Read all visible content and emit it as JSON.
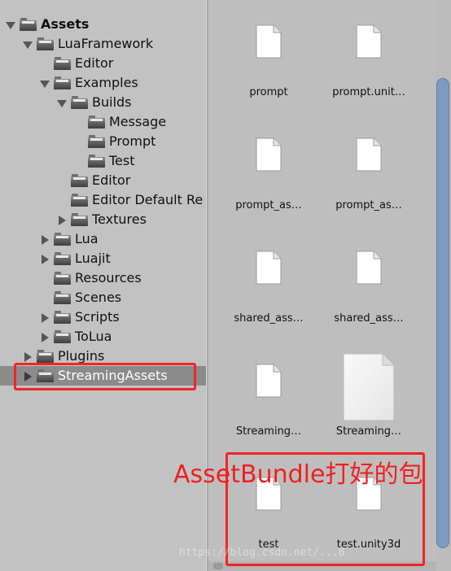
{
  "tree": [
    {
      "label": "Assets",
      "depth": 0,
      "state": "expanded",
      "bold": true
    },
    {
      "label": "LuaFramework",
      "depth": 1,
      "state": "expanded"
    },
    {
      "label": "Editor",
      "depth": 2,
      "state": "none"
    },
    {
      "label": "Examples",
      "depth": 2,
      "state": "expanded"
    },
    {
      "label": "Builds",
      "depth": 3,
      "state": "expanded"
    },
    {
      "label": "Message",
      "depth": 4,
      "state": "none"
    },
    {
      "label": "Prompt",
      "depth": 4,
      "state": "none"
    },
    {
      "label": "Test",
      "depth": 4,
      "state": "none"
    },
    {
      "label": "Editor",
      "depth": 3,
      "state": "none"
    },
    {
      "label": "Editor Default Re",
      "depth": 3,
      "state": "none"
    },
    {
      "label": "Textures",
      "depth": 3,
      "state": "collapsed"
    },
    {
      "label": "Lua",
      "depth": 2,
      "state": "collapsed"
    },
    {
      "label": "Luajit",
      "depth": 2,
      "state": "collapsed"
    },
    {
      "label": "Resources",
      "depth": 2,
      "state": "none"
    },
    {
      "label": "Scenes",
      "depth": 2,
      "state": "none"
    },
    {
      "label": "Scripts",
      "depth": 2,
      "state": "collapsed"
    },
    {
      "label": "ToLua",
      "depth": 2,
      "state": "collapsed"
    },
    {
      "label": "Plugins",
      "depth": 1,
      "state": "collapsed"
    },
    {
      "label": "StreamingAssets",
      "depth": 1,
      "state": "collapsed",
      "selected": true
    }
  ],
  "files": [
    {
      "name": "prompt",
      "icon": "file-icon"
    },
    {
      "name": "prompt.unit…",
      "icon": "file-icon"
    },
    {
      "name": "prompt_as…",
      "icon": "file-icon"
    },
    {
      "name": "prompt_as…",
      "icon": "file-icon"
    },
    {
      "name": "shared_ass…",
      "icon": "file-icon"
    },
    {
      "name": "shared_ass…",
      "icon": "file-icon"
    },
    {
      "name": "Streaming…",
      "icon": "file-icon"
    },
    {
      "name": "Streaming…",
      "icon": "manifest-file-icon"
    },
    {
      "name": "test",
      "icon": "file-icon"
    },
    {
      "name": "test.unity3d",
      "icon": "file-icon"
    }
  ],
  "annotation": "AssetBundle打好的包",
  "watermark": "https://blog.csdn.net/...8",
  "colors": {
    "highlight_box": "#f32424",
    "selection": "#8b8b8b",
    "scrollbar_thumb": "#7e9bbf"
  }
}
